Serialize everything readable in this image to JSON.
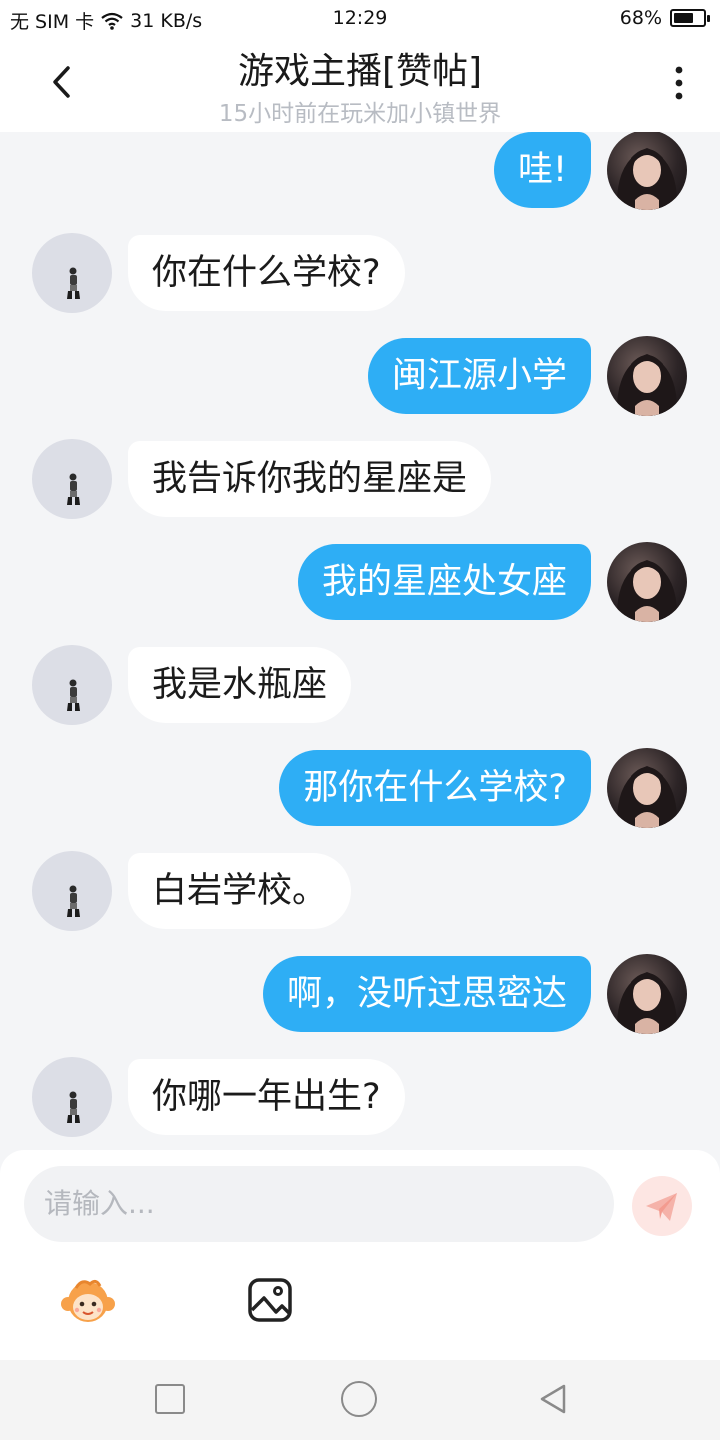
{
  "status_bar": {
    "carrier": "无 SIM 卡",
    "net_speed": "31 KB/s",
    "time": "12:29",
    "battery_percent": "68%",
    "battery_level": 0.68
  },
  "header": {
    "title": "游戏主播[赞帖]",
    "subtitle": "15小时前在玩米加小镇世界"
  },
  "messages": [
    {
      "side": "right",
      "text": "哇!"
    },
    {
      "side": "left",
      "text": "你在什么学校?"
    },
    {
      "side": "right",
      "text": "闽江源小学"
    },
    {
      "side": "left",
      "text": "我告诉你我的星座是"
    },
    {
      "side": "right",
      "text": "我的星座处女座"
    },
    {
      "side": "left",
      "text": "我是水瓶座"
    },
    {
      "side": "right",
      "text": "那你在什么学校?"
    },
    {
      "side": "left",
      "text": "白岩学校。"
    },
    {
      "side": "right",
      "text": "啊，没听过思密达"
    },
    {
      "side": "left",
      "text": "你哪一年出生?"
    }
  ],
  "input": {
    "placeholder": "请输入..."
  },
  "colors": {
    "accent_blue": "#2eaef5",
    "send_button_bg": "#fde6e3",
    "send_icon": "#f39b8f",
    "background": "#f4f5f7"
  },
  "icons": {
    "back": "chevron-left-icon",
    "more": "more-vertical-icon",
    "send": "paper-plane-icon",
    "emoji": "monkey-emoji-icon",
    "image": "image-icon"
  }
}
